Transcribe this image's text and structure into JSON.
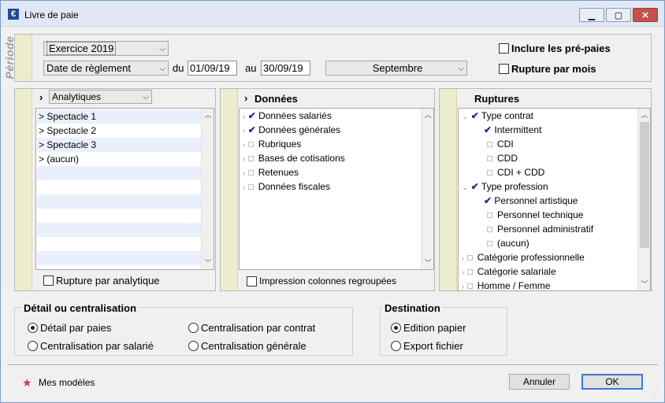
{
  "window": {
    "title": "Livre de paie",
    "icon": "euro-icon"
  },
  "periode": {
    "label": "Période",
    "exercice": "Exercice 2019",
    "date_type": "Date de règlement",
    "du_label": "du",
    "du_value": "01/09/19",
    "au_label": "au",
    "au_value": "30/09/19",
    "mois": "Septembre",
    "inclure_label": "Inclure les pré-paies",
    "rupture_mois_label": "Rupture par mois"
  },
  "analytique": {
    "select": "Analytiques",
    "items": [
      "> Spectacle 1",
      "> Spectacle 2",
      "> Spectacle 3",
      "> (aucun)"
    ],
    "rupture_label": "Rupture par analytique"
  },
  "donnees": {
    "title": "Données",
    "items": [
      {
        "label": "Données salariés",
        "checked": true
      },
      {
        "label": "Données générales",
        "checked": true
      },
      {
        "label": "Rubriques",
        "checked": false
      },
      {
        "label": "Bases de cotisations",
        "checked": false
      },
      {
        "label": "Retenues",
        "checked": false
      },
      {
        "label": "Données fiscales",
        "checked": false
      }
    ],
    "impression_label": "Impression colonnes regroupées"
  },
  "ruptures": {
    "title": "Ruptures",
    "items": [
      {
        "label": "Type contrat",
        "level": 0,
        "checked": true,
        "expanded": true
      },
      {
        "label": "Intermittent",
        "level": 1,
        "checked": true
      },
      {
        "label": "CDI",
        "level": 1,
        "checked": false
      },
      {
        "label": "CDD",
        "level": 1,
        "checked": false
      },
      {
        "label": "CDI + CDD",
        "level": 1,
        "checked": false
      },
      {
        "label": "Type profession",
        "level": 0,
        "checked": true,
        "expanded": true
      },
      {
        "label": "Personnel artistique",
        "level": 1,
        "checked": true
      },
      {
        "label": "Personnel technique",
        "level": 1,
        "checked": false
      },
      {
        "label": "Personnel administratif",
        "level": 1,
        "checked": false
      },
      {
        "label": "(aucun)",
        "level": 1,
        "checked": false
      },
      {
        "label": "Catégorie professionnelle",
        "level": 0,
        "checked": false,
        "expanded": false
      },
      {
        "label": "Catégorie salariale",
        "level": 0,
        "checked": false,
        "expanded": false
      },
      {
        "label": "Homme / Femme",
        "level": 0,
        "checked": false,
        "expanded": false
      }
    ]
  },
  "detail": {
    "title": "Détail ou centralisation",
    "options": [
      "Détail par paies",
      "Centralisation par contrat",
      "Centralisation par salarié",
      "Centralisation générale"
    ],
    "selected": "Détail par paies"
  },
  "destination": {
    "title": "Destination",
    "options": [
      "Edition papier",
      "Export fichier"
    ],
    "selected": "Edition papier"
  },
  "footer": {
    "modeles_label": "Mes modèles",
    "annuler": "Annuler",
    "ok": "OK"
  },
  "colors": {
    "accent": "#1c2f84",
    "strip": "#eeeccf",
    "row_alt": "#eaf0fb",
    "star": "#d6336c"
  }
}
